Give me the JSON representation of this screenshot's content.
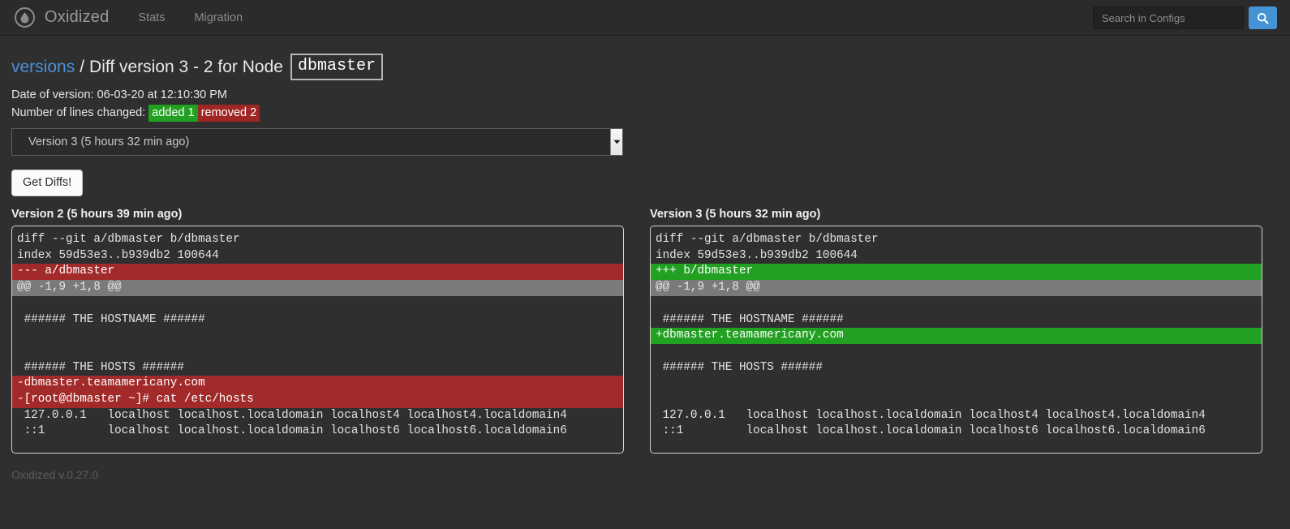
{
  "navbar": {
    "logo_icon": "droplet-circle-icon",
    "brand": "Oxidized",
    "links": [
      {
        "label": "Stats"
      },
      {
        "label": "Migration"
      }
    ],
    "search": {
      "placeholder": "Search in Configs",
      "value": "",
      "button_icon": "search-icon",
      "button_color": "#4593d4"
    }
  },
  "breadcrumb": {
    "link": "versions",
    "separator": "/",
    "title": "Diff version 3 - 2 for Node",
    "node": "dbmaster"
  },
  "meta": {
    "date_label": "Date of version: 06-03-20 at 12:10:30 PM",
    "lines_changed_label": "Number of lines changed:",
    "added_badge": "added 1",
    "removed_badge": "removed 2",
    "added_color": "#22a022",
    "removed_color": "#a02626"
  },
  "version_select": {
    "selected": "Version 3 (5 hours 32 min ago)",
    "arrow_icon": "chevron-down-icon"
  },
  "get_diffs_button": "Get Diffs!",
  "panels": [
    {
      "title": "Version 2 (5 hours 39 min ago)",
      "lines": [
        {
          "text": "diff --git a/dbmaster b/dbmaster",
          "type": "context"
        },
        {
          "text": "index 59d53e3..b939db2 100644",
          "type": "context"
        },
        {
          "text": "--- a/dbmaster",
          "type": "del"
        },
        {
          "text": "@@ -1,9 +1,8 @@",
          "type": "hunk"
        },
        {
          "text": "",
          "type": "context"
        },
        {
          "text": " ###### THE HOSTNAME ######",
          "type": "context"
        },
        {
          "text": "",
          "type": "context"
        },
        {
          "text": "",
          "type": "context"
        },
        {
          "text": " ###### THE HOSTS ######",
          "type": "context"
        },
        {
          "text": "-dbmaster.teamamericany.com",
          "type": "del"
        },
        {
          "text": "-[root@dbmaster ~]# cat /etc/hosts",
          "type": "del"
        },
        {
          "text": " 127.0.0.1   localhost localhost.localdomain localhost4 localhost4.localdomain4",
          "type": "context"
        },
        {
          "text": " ::1         localhost localhost.localdomain localhost6 localhost6.localdomain6",
          "type": "context"
        }
      ]
    },
    {
      "title": "Version 3 (5 hours 32 min ago)",
      "lines": [
        {
          "text": "diff --git a/dbmaster b/dbmaster",
          "type": "context"
        },
        {
          "text": "index 59d53e3..b939db2 100644",
          "type": "context"
        },
        {
          "text": "+++ b/dbmaster",
          "type": "add"
        },
        {
          "text": "@@ -1,9 +1,8 @@",
          "type": "hunk"
        },
        {
          "text": "",
          "type": "context"
        },
        {
          "text": " ###### THE HOSTNAME ######",
          "type": "context"
        },
        {
          "text": "+dbmaster.teamamericany.com",
          "type": "add"
        },
        {
          "text": "",
          "type": "context"
        },
        {
          "text": " ###### THE HOSTS ######",
          "type": "context"
        },
        {
          "text": "",
          "type": "context"
        },
        {
          "text": "",
          "type": "context"
        },
        {
          "text": " 127.0.0.1   localhost localhost.localdomain localhost4 localhost4.localdomain4",
          "type": "context"
        },
        {
          "text": " ::1         localhost localhost.localdomain localhost6 localhost6.localdomain6",
          "type": "context"
        }
      ]
    }
  ],
  "footer": "Oxidized v.0.27.0"
}
